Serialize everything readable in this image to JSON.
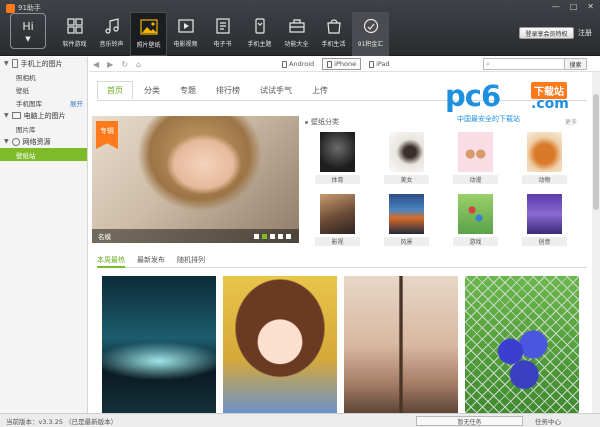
{
  "window": {
    "title": "91助手",
    "controls": [
      "—",
      "□",
      "✕"
    ]
  },
  "hi_button": {
    "label": "Hi"
  },
  "nav": [
    {
      "label": "软件游戏",
      "icon": "apps-grid-icon"
    },
    {
      "label": "音乐铃声",
      "icon": "music-note-icon"
    },
    {
      "label": "照片壁纸",
      "icon": "picture-icon",
      "active": true
    },
    {
      "label": "电影视频",
      "icon": "video-play-icon"
    },
    {
      "label": "电子书",
      "icon": "ebook-icon"
    },
    {
      "label": "手机主题",
      "icon": "phone-theme-icon"
    },
    {
      "label": "功能大全",
      "icon": "toolbox-icon"
    },
    {
      "label": "手机生活",
      "icon": "shopping-bag-icon"
    },
    {
      "label": "91积金汇",
      "icon": "coin-icon"
    }
  ],
  "account": {
    "login": "登录享会员特权",
    "register": "注册"
  },
  "sidebar": {
    "groups": [
      {
        "title": "手机上的图片",
        "items": [
          {
            "label": "照相机"
          },
          {
            "label": "壁纸"
          },
          {
            "label": "手机图库",
            "extra": "展开"
          }
        ]
      },
      {
        "title": "电脑上的图片",
        "items": [
          {
            "label": "图片库"
          }
        ]
      },
      {
        "title": "网络资源",
        "items": [
          {
            "label": "壁纸站"
          }
        ]
      }
    ]
  },
  "device_tabs": [
    "Android",
    "iPhone",
    "iPad"
  ],
  "search": {
    "button": "搜索"
  },
  "tabs": [
    "首页",
    "分类",
    "专题",
    "排行榜",
    "试试手气",
    "上传"
  ],
  "logo": {
    "main": "pc6",
    "badge": "下载站",
    "suffix": ".com",
    "slogan": "中国最安全的下载站"
  },
  "banner": {
    "tag": "专辑",
    "caption": "名模",
    "dots": 5,
    "active_dot": 1
  },
  "categories": {
    "title": "壁纸分类",
    "more": "更多",
    "items": [
      "体育",
      "美女",
      "动漫",
      "动物",
      "影视",
      "风景",
      "游戏",
      "创意"
    ]
  },
  "subtabs": [
    "本周最热",
    "最新发布",
    "随机排列"
  ],
  "status": {
    "version": "当前版本：v3.3.25 （已是最新版本）",
    "task": "暂无任务",
    "center": "任务中心"
  },
  "colors": {
    "accent": "#7dbb2b",
    "topbar": "#2f3135",
    "brand_orange": "#ff7a1a",
    "brand_blue": "#1e90e0"
  }
}
